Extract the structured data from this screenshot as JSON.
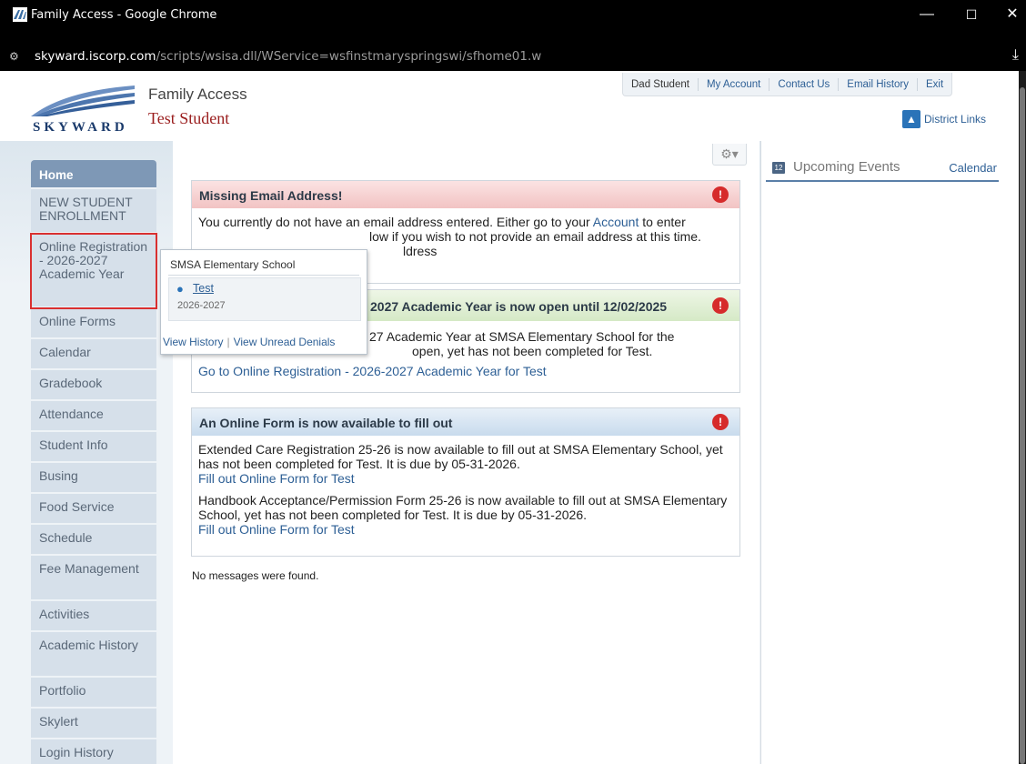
{
  "browser": {
    "window_title": "Family Access - Google Chrome",
    "url_host": "skyward.iscorp.com",
    "url_path": "/scripts/wsisa.dll/WService=wsfinstmaryspringswi/sfhome01.w"
  },
  "header": {
    "logo_text": "SKYWARD",
    "app_title": "Family Access",
    "student_name": "Test Student",
    "topnav": [
      "Dad Student",
      "My Account",
      "Contact Us",
      "Email History",
      "Exit"
    ],
    "district_links": "District Links"
  },
  "sidebar": {
    "items": [
      "Home",
      "NEW STUDENT ENROLLMENT",
      "Online Registration - 2026-2027 Academic Year",
      "Online Forms",
      "Calendar",
      "Gradebook",
      "Attendance",
      "Student Info",
      "Busing",
      "Food Service",
      "Schedule",
      "Fee Management",
      "Activities",
      "Academic History",
      "Portfolio",
      "Skylert",
      "Login History"
    ]
  },
  "popup": {
    "school": "SMSA Elementary School",
    "student": "Test",
    "year": "2026-2027",
    "view_history": "View History",
    "separator": "|",
    "view_unread_denials": "View Unread Denials"
  },
  "messages": {
    "email": {
      "title": "Missing Email Address!",
      "line1_pre": "You currently do not have an email address entered. Either go to your ",
      "account_link": "Account",
      "line1_post": " to enter",
      "line2_visible": "low if you wish to not provide an email address at this time.",
      "line3_visible": "ldress"
    },
    "registration": {
      "title_visible": "2027 Academic Year is now open until 12/02/2025",
      "line1_visible": "27 Academic Year at SMSA Elementary School for the",
      "line2_visible": "open, yet has not been completed for Test.",
      "link": "Go to Online Registration - 2026-2027 Academic Year for Test"
    },
    "forms": {
      "title": "An Online Form is now available to fill out",
      "item1": "Extended Care Registration 25-26 is now available to fill out at SMSA Elementary School, yet has not been completed for Test.  It is due by 05-31-2026.",
      "item1_link": "Fill out Online Form for Test",
      "item2": "Handbook Acceptance/Permission Form 25-26 is now available to fill out at SMSA Elementary School, yet has not been completed for Test.  It is due by 05-31-2026.",
      "item2_link": "Fill out Online Form for Test"
    },
    "no_messages": "No messages were found."
  },
  "events": {
    "title": "Upcoming Events",
    "calendar_link": "Calendar"
  },
  "colors": {
    "accent_blue": "#2d5f95",
    "student_red": "#9a1d1d",
    "highlight_red": "#d93030",
    "home_bg": "#7e98b6"
  }
}
